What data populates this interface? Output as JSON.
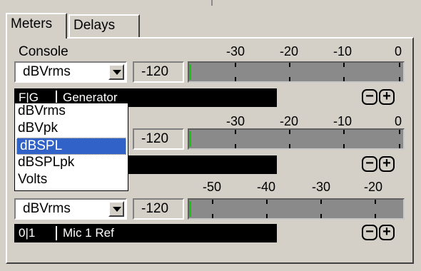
{
  "tabs": [
    {
      "label": "Meters",
      "active": true
    },
    {
      "label": "Delays",
      "active": false
    }
  ],
  "sections": [
    {
      "label": "Console",
      "scale": [
        "-30",
        "-20",
        "-10",
        "0"
      ],
      "unit_value": "dBVrms",
      "level": "-120",
      "channel_id": "F|G",
      "channel_name": "Generator"
    },
    {
      "label": "",
      "scale": [
        "-30",
        "-20",
        "-10",
        "0"
      ],
      "unit_value": "dBVrms",
      "level": "-120",
      "channel_id": "",
      "channel_name": ""
    },
    {
      "label": "",
      "scale": [
        "-50",
        "-40",
        "-30",
        "-20"
      ],
      "unit_value": "dBVrms",
      "level": "-120",
      "channel_id": "0|1",
      "channel_name": "Mic 1 Ref"
    }
  ],
  "unit_options": [
    "dBVrms",
    "dBVpk",
    "dBSPL",
    "dBSPLpk",
    "Volts"
  ],
  "selected_option": "dBSPL",
  "buttons": {
    "minus": "−",
    "plus": "+"
  },
  "colors": {
    "meter_signal": "#18c018",
    "selection": "#3162c7"
  }
}
